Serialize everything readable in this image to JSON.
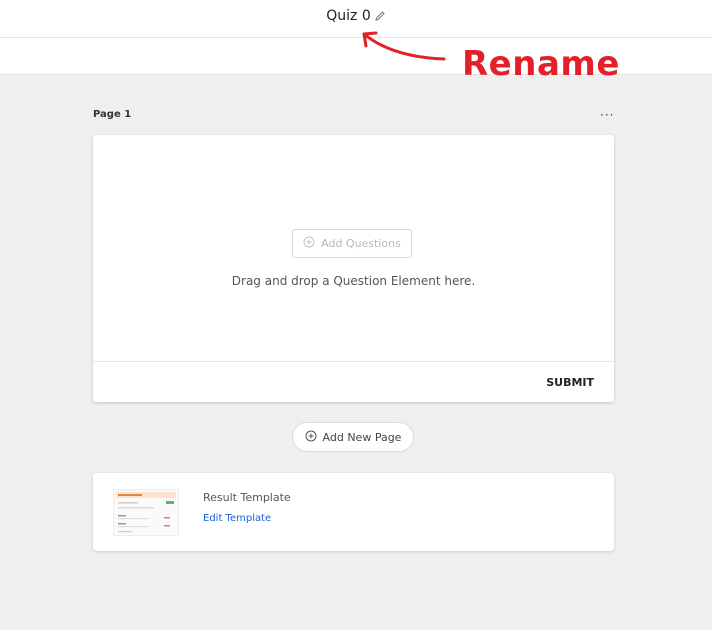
{
  "header": {
    "quiz_title": "Quiz 0",
    "edit_icon": "pencil-icon"
  },
  "annotation": {
    "label": "Rename",
    "color": "#e32027"
  },
  "page": {
    "label": "Page 1",
    "more_icon": "ellipsis-icon",
    "more_text": "···",
    "add_questions_label": "Add Questions",
    "drop_hint": "Drag and drop a Question Element here.",
    "submit_label": "SUBMIT"
  },
  "add_page": {
    "label": "Add New Page",
    "icon": "plus-circle-icon"
  },
  "result": {
    "title": "Result Template",
    "edit_label": "Edit Template"
  },
  "colors": {
    "background": "#efefef",
    "link": "#1a63d6",
    "card": "#ffffff"
  }
}
